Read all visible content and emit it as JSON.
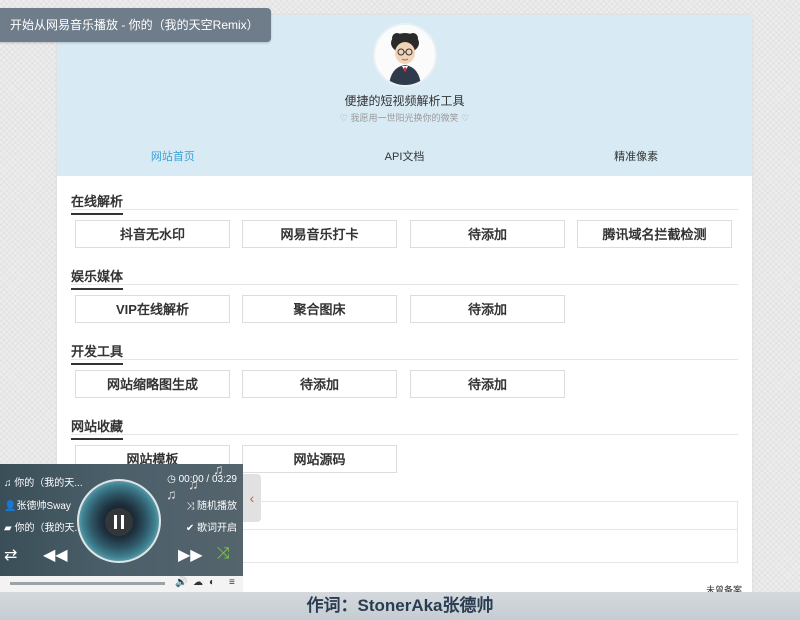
{
  "notice": "开始从网易音乐播放 - 你的（我的天空Remix）",
  "hero": {
    "title": "便捷的短视频解析工具",
    "subtitle": "♡ 我愿用一世阳光换你的微笑 ♡"
  },
  "nav": [
    "网站首页",
    "API文档",
    "精准像素"
  ],
  "sections": {
    "online": {
      "title": "在线解析",
      "buttons": [
        "抖音无水印",
        "网易音乐打卡",
        "待添加",
        "腾讯域名拦截检测"
      ]
    },
    "fun": {
      "title": "娱乐媒体",
      "buttons": [
        "VIP在线解析",
        "聚合图床",
        "待添加"
      ]
    },
    "dev": {
      "title": "开发工具",
      "buttons": [
        "网站缩略图生成",
        "待添加",
        "待添加"
      ]
    },
    "fav": {
      "title": "网站收藏",
      "buttons": [
        "网站模板",
        "网站源码"
      ]
    }
  },
  "footer": {
    "right": "未曾备案"
  },
  "player": {
    "song": "你的（我的天...",
    "artist": "张德帅Sway",
    "album": "你的（我的天...",
    "time": "00:00 / 03:29",
    "mode": "随机播放",
    "lyrics_status": "歌词开启",
    "progress": 0.0
  },
  "lyric": "作词：StonerAka张德帅",
  "colors": {
    "hero_bg": "#d8ebf5",
    "nav_active": "#3aa0d8",
    "shuffle": "#7bd13a"
  }
}
